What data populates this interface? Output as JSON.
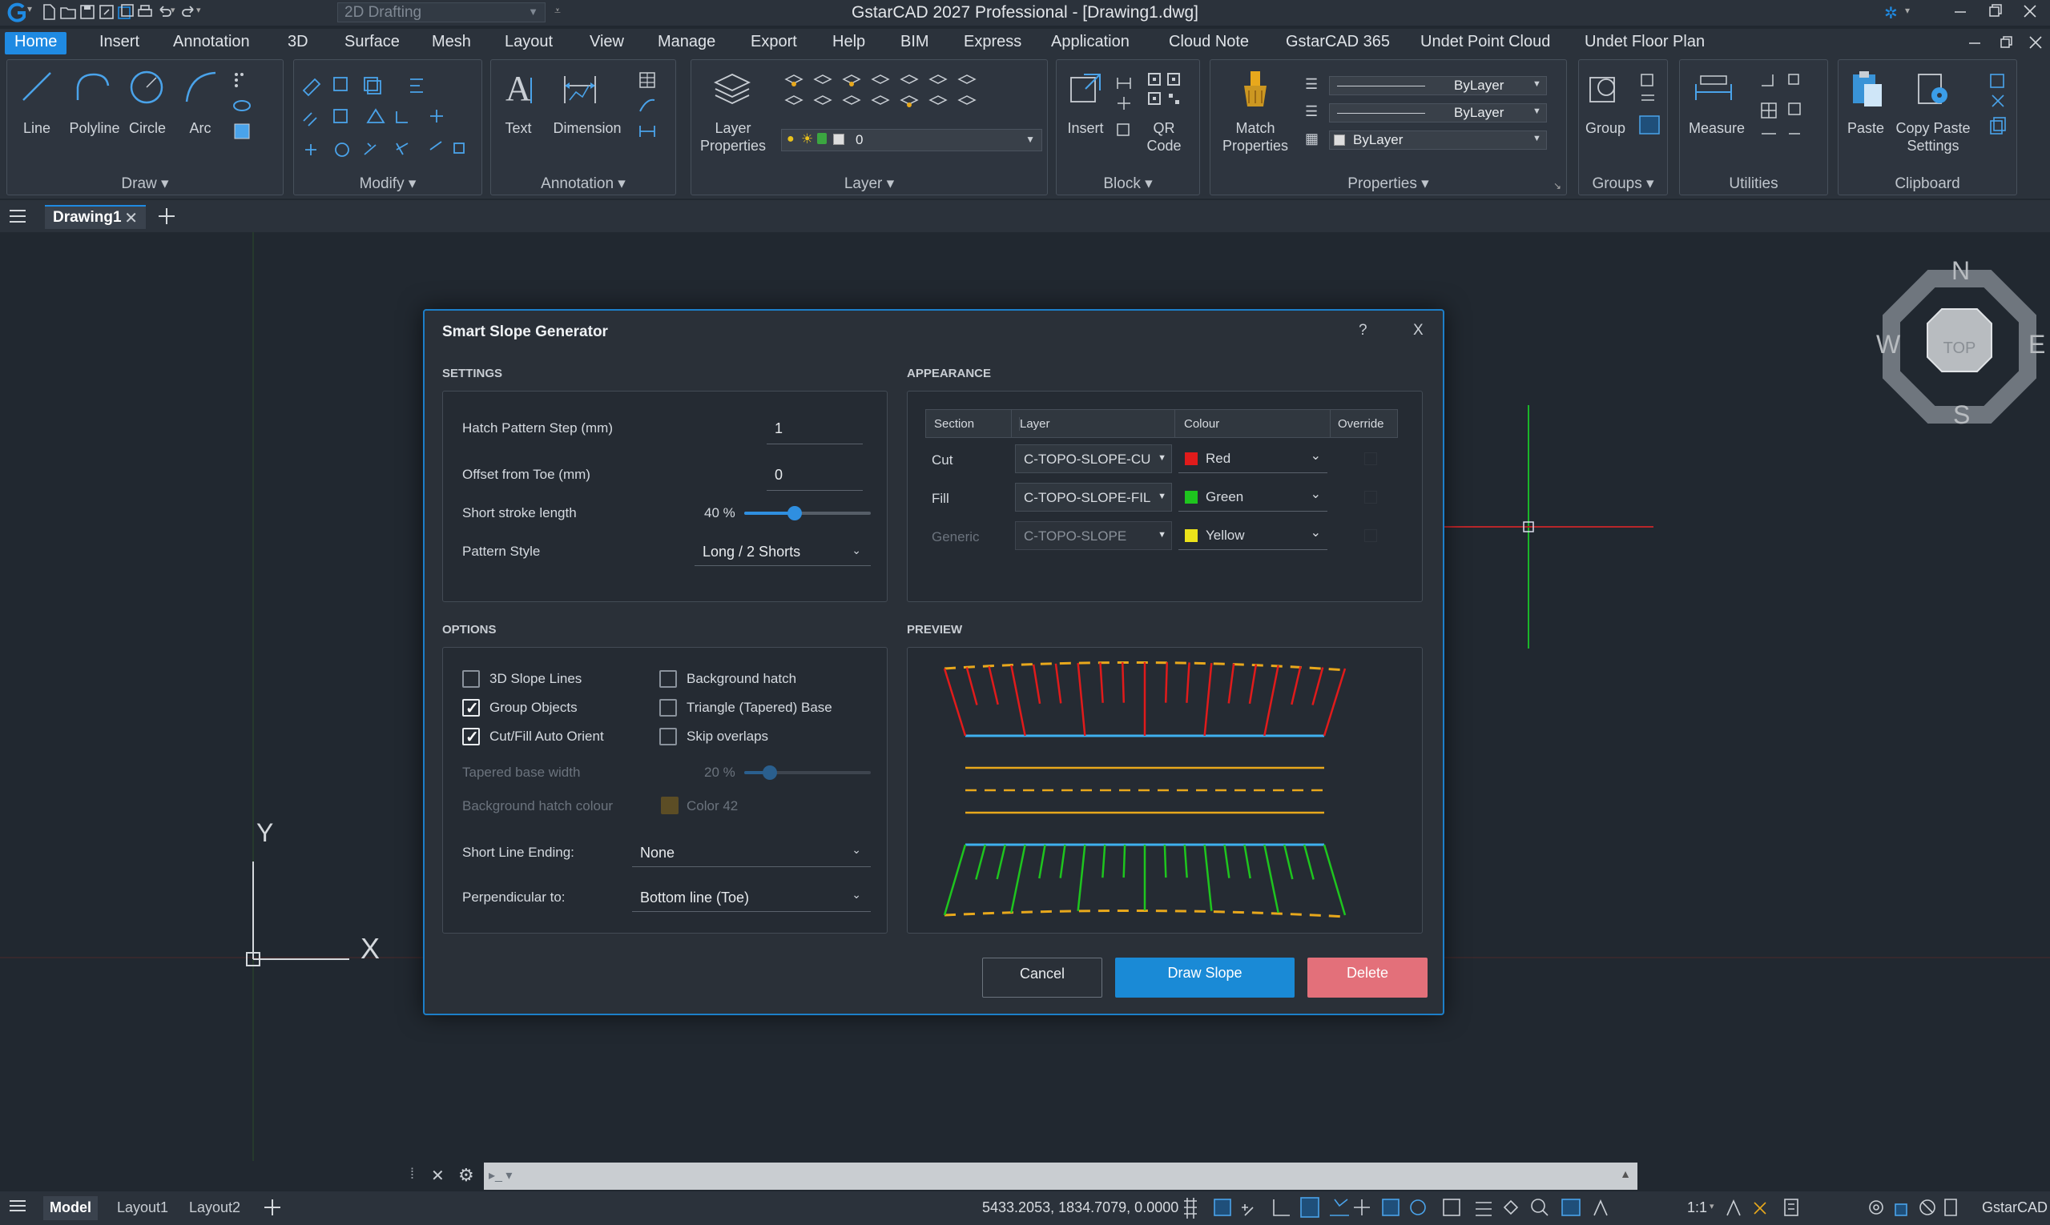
{
  "app": {
    "title": "GstarCAD 2027 Professional - [Drawing1.dwg]",
    "workspace": "2D Drafting",
    "window_buttons": [
      "minimize",
      "restore",
      "close"
    ]
  },
  "menu": [
    "Home",
    "Insert",
    "Annotation",
    "3D",
    "Surface",
    "Mesh",
    "Layout",
    "View",
    "Manage",
    "Export",
    "Help",
    "BIM",
    "Express",
    "Application",
    "Cloud Note",
    "GstarCAD 365",
    "Undet Point Cloud",
    "Undet Floor Plan"
  ],
  "ribbon": {
    "draw": {
      "title": "Draw ▾",
      "tools": [
        "Line",
        "Polyline",
        "Circle",
        "Arc"
      ]
    },
    "modify": {
      "title": "Modify ▾"
    },
    "annotation": {
      "title": "Annotation ▾",
      "tools": [
        "Text",
        "Dimension"
      ]
    },
    "layer": {
      "title": "Layer ▾",
      "tool": "Layer Properties",
      "current": "0"
    },
    "block": {
      "title": "Block ▾",
      "tools": [
        "Insert",
        "QR Code"
      ]
    },
    "properties": {
      "title": "Properties ▾",
      "tool": "Match Properties",
      "rows": [
        "ByLayer",
        "ByLayer",
        "ByLayer"
      ]
    },
    "groups": {
      "title": "Groups ▾",
      "tool": "Group"
    },
    "utilities": {
      "title": "Utilities",
      "tool": "Measure"
    },
    "clipboard": {
      "title": "Clipboard",
      "tools": [
        "Paste",
        "Copy Paste Settings"
      ]
    }
  },
  "doc_tab": "Drawing1",
  "viewcube": {
    "n": "N",
    "s": "S",
    "e": "E",
    "w": "W",
    "face": "TOP"
  },
  "dialog": {
    "title": "Smart Slope Generator",
    "help": "?",
    "close": "X",
    "settings": {
      "title": "SETTINGS",
      "hatch_step_label": "Hatch Pattern Step (mm)",
      "hatch_step_value": "1",
      "offset_label": "Offset from Toe (mm)",
      "offset_value": "0",
      "short_stroke_label": "Short stroke length",
      "short_stroke_value": "40 %",
      "short_stroke_percent": 40,
      "pattern_label": "Pattern Style",
      "pattern_value": "Long / 2 Shorts"
    },
    "appearance": {
      "title": "APPEARANCE",
      "headers": [
        "Section",
        "Layer",
        "Colour",
        "Override"
      ],
      "rows": [
        {
          "section": "Cut",
          "layer": "C-TOPO-SLOPE-CUT",
          "colour": "Red",
          "swatch": "#e01b1b",
          "dim": false
        },
        {
          "section": "Fill",
          "layer": "C-TOPO-SLOPE-FILL",
          "colour": "Green",
          "swatch": "#1ec51e",
          "dim": false
        },
        {
          "section": "Generic",
          "layer": "C-TOPO-SLOPE",
          "colour": "Yellow",
          "swatch": "#ece31a",
          "dim": true
        }
      ]
    },
    "options": {
      "title": "OPTIONS",
      "checks_left": [
        {
          "label": "3D Slope Lines",
          "checked": false
        },
        {
          "label": "Group Objects",
          "checked": true
        },
        {
          "label": "Cut/Fill Auto Orient",
          "checked": true
        }
      ],
      "checks_right": [
        {
          "label": "Background hatch",
          "checked": false
        },
        {
          "label": "Triangle (Tapered) Base",
          "checked": false
        },
        {
          "label": "Skip overlaps",
          "checked": false
        }
      ],
      "tapered_label": "Tapered base width",
      "tapered_value": "20 %",
      "tapered_percent": 20,
      "bg_colour_label": "Background hatch colour",
      "bg_colour_value": "Color 42",
      "bg_colour_swatch": "#8a6a1a",
      "ending_label": "Short Line Ending:",
      "ending_value": "None",
      "perp_label": "Perpendicular to:",
      "perp_value": "Bottom line (Toe)"
    },
    "preview": {
      "title": "PREVIEW"
    },
    "buttons": {
      "cancel": "Cancel",
      "draw": "Draw Slope",
      "delete": "Delete"
    }
  },
  "ucs": {
    "x": "X",
    "y": "Y"
  },
  "status": {
    "tabs": [
      "Model",
      "Layout1",
      "Layout2"
    ],
    "coords": "5433.2053, 1834.7079, 0.0000",
    "scale": "1:1",
    "brand": "GstarCAD"
  },
  "colors": {
    "accent": "#1f8ae2",
    "delete": "#e3707a",
    "cut": "#e01b1b",
    "fill": "#1ec51e",
    "toe": "#e8a81c",
    "daylight": "#3fb0ef"
  }
}
